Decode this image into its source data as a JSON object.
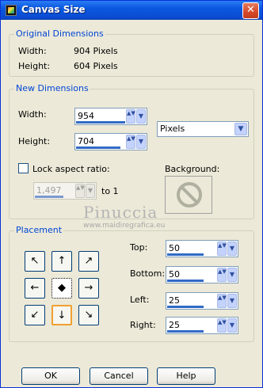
{
  "window": {
    "title": "Canvas Size",
    "close_glyph": "✕"
  },
  "original": {
    "group_label": "Original Dimensions",
    "width_label": "Width:",
    "width_value": "904 Pixels",
    "height_label": "Height:",
    "height_value": "604 Pixels"
  },
  "new_dims": {
    "group_label": "New Dimensions",
    "width_label": "Width:",
    "width_value": "954",
    "height_label": "Height:",
    "height_value": "704",
    "units_value": "Pixels",
    "lock_label": "Lock aspect ratio:",
    "background_label": "Background:",
    "ratio_value": "1,497",
    "ratio_suffix": "to 1"
  },
  "watermark": {
    "line1": "Pinuccia",
    "line2": "www.maidiregrafica.eu"
  },
  "placement": {
    "group_label": "Placement",
    "top_label": "Top:",
    "top_value": "50",
    "bottom_label": "Bottom:",
    "bottom_value": "50",
    "left_label": "Left:",
    "left_value": "25",
    "right_label": "Right:",
    "right_value": "25",
    "anchors": [
      "↖",
      "↑",
      "↗",
      "←",
      "◆",
      "→",
      "↙",
      "↓",
      "↘"
    ]
  },
  "buttons": {
    "ok": "OK",
    "cancel": "Cancel",
    "help": "Help"
  },
  "icons": {
    "spin_arrows": "▲▼",
    "dropdown": "▼"
  }
}
